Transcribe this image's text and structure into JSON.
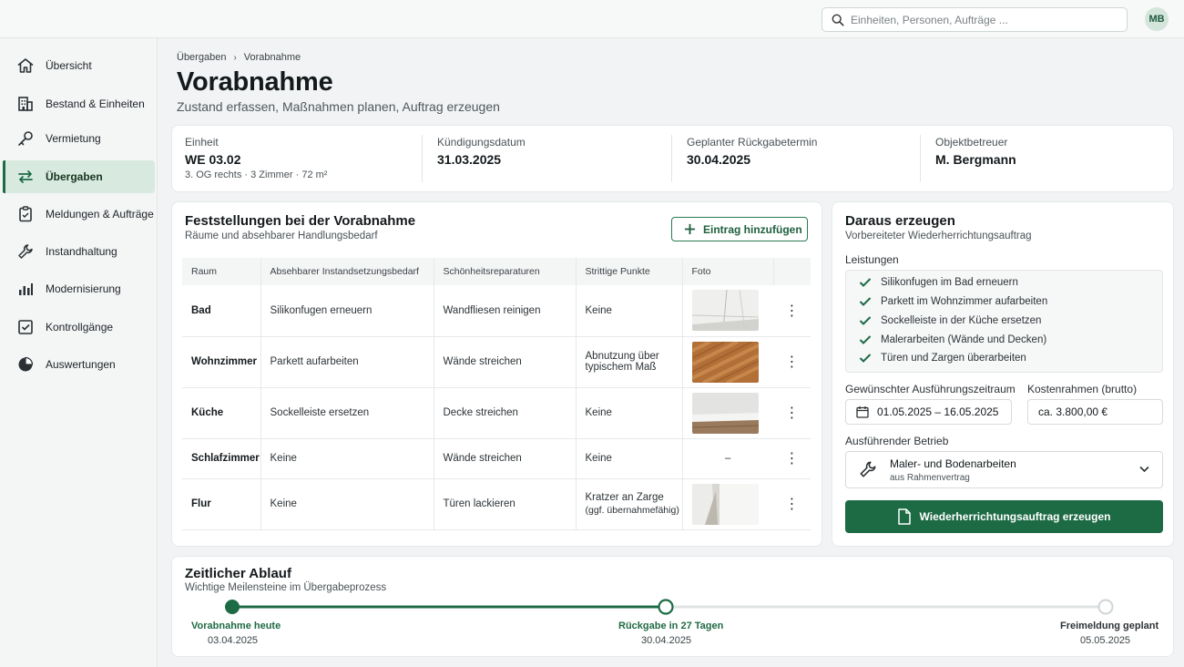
{
  "search": {
    "placeholder": "Einheiten, Personen, Aufträge ..."
  },
  "user": {
    "initials": "MB"
  },
  "sidebar": {
    "items": [
      {
        "label": "Übersicht",
        "icon": "home-icon"
      },
      {
        "label": "Bestand & Einheiten",
        "icon": "building-icon"
      },
      {
        "label": "Vermietung",
        "icon": "key-icon"
      },
      {
        "label": "Übergaben",
        "icon": "swap-arrows-icon",
        "active": true
      },
      {
        "label": "Meldungen & Aufträge",
        "icon": "clipboard-icon"
      },
      {
        "label": "Instandhaltung",
        "icon": "wrench-icon"
      },
      {
        "label": "Modernisierung",
        "icon": "bar-chart-icon"
      },
      {
        "label": "Kontrollgänge",
        "icon": "checklist-icon"
      },
      {
        "label": "Auswertungen",
        "icon": "pie-chart-icon"
      }
    ]
  },
  "breadcrumb": {
    "parent": "Übergaben",
    "current": "Vorabnahme"
  },
  "page": {
    "title": "Vorabnahme",
    "subtitle": "Zustand erfassen, Maßnahmen planen, Auftrag erzeugen"
  },
  "info": {
    "unit": {
      "label": "Einheit",
      "value": "WE 03.02",
      "detail": "3. OG rechts · 3 Zimmer · 72 m²"
    },
    "termination": {
      "label": "Kündigungsdatum",
      "value": "31.03.2025"
    },
    "return": {
      "label": "Geplanter Rückgabetermin",
      "value": "30.04.2025"
    },
    "manager": {
      "label": "Objektbetreuer",
      "value": "M. Bergmann"
    }
  },
  "findings": {
    "title": "Feststellungen bei der Vorabnahme",
    "subtitle": "Räume und absehbarer Handlungsbedarf",
    "add_label": "Eintrag hinzufügen",
    "columns": [
      "Raum",
      "Absehbarer Instandsetzungsbedarf",
      "Schönheitsreparaturen",
      "Strittige Punkte",
      "Foto"
    ],
    "rows": [
      {
        "room": "Bad",
        "repair": "Silikonfugen erneuern",
        "cosmetic": "Wandfliesen reinigen",
        "disputed": "Keine",
        "disputed_note": "",
        "photo": "tiles"
      },
      {
        "room": "Wohnzimmer",
        "repair": "Parkett aufarbeiten",
        "cosmetic": "Wände streichen",
        "disputed": "Abnutzung über typischem Maß",
        "disputed_note": "",
        "photo": "parquet"
      },
      {
        "room": "Küche",
        "repair": "Sockelleiste ersetzen",
        "cosmetic": "Decke streichen",
        "disputed": "Keine",
        "disputed_note": "",
        "photo": "baseboard"
      },
      {
        "room": "Schlafzimmer",
        "repair": "Keine",
        "cosmetic": "Wände streichen",
        "disputed": "Keine",
        "disputed_note": "",
        "photo": "–"
      },
      {
        "room": "Flur",
        "repair": "Keine",
        "cosmetic": "Türen lackieren",
        "disputed": "Kratzer an Zarge",
        "disputed_note": "(ggf. übernahmefähig)",
        "photo": "door-frame"
      }
    ]
  },
  "create": {
    "title": "Daraus erzeugen",
    "subtitle": "Vorbereiteter Wiederherrichtungsauftrag",
    "services_label": "Leistungen",
    "services": [
      "Silikonfugen im Bad erneuern",
      "Parkett im Wohnzimmer aufarbeiten",
      "Sockelleiste in der Küche ersetzen",
      "Malerarbeiten (Wände und Decken)",
      "Türen und Zargen überarbeiten"
    ],
    "period_label": "Gewünschter Ausführungszeitraum",
    "period_value": "01.05.2025 – 16.05.2025",
    "budget_label": "Kostenrahmen (brutto)",
    "budget_value": "ca. 3.800,00 €",
    "contractor_label": "Ausführender Betrieb",
    "contractor_name": "Maler- und Bodenarbeiten",
    "contractor_note": "aus Rahmenvertrag",
    "submit_label": "Wiederherrichtungsauftrag erzeugen"
  },
  "timeline": {
    "title": "Zeitlicher Ablauf",
    "subtitle": "Wichtige Meilensteine im Übergabeprozess",
    "progress": 0.5,
    "milestones": [
      {
        "label": "Vorabnahme heute",
        "date": "03.04.2025",
        "state": "done"
      },
      {
        "label": "Rückgabe in 27 Tagen",
        "date": "30.04.2025",
        "state": "current"
      },
      {
        "label": "Freimeldung geplant",
        "date": "05.05.2025",
        "state": "planned"
      }
    ]
  },
  "colors": {
    "accent": "#1d6b45",
    "accent_light": "#d8eadf"
  }
}
